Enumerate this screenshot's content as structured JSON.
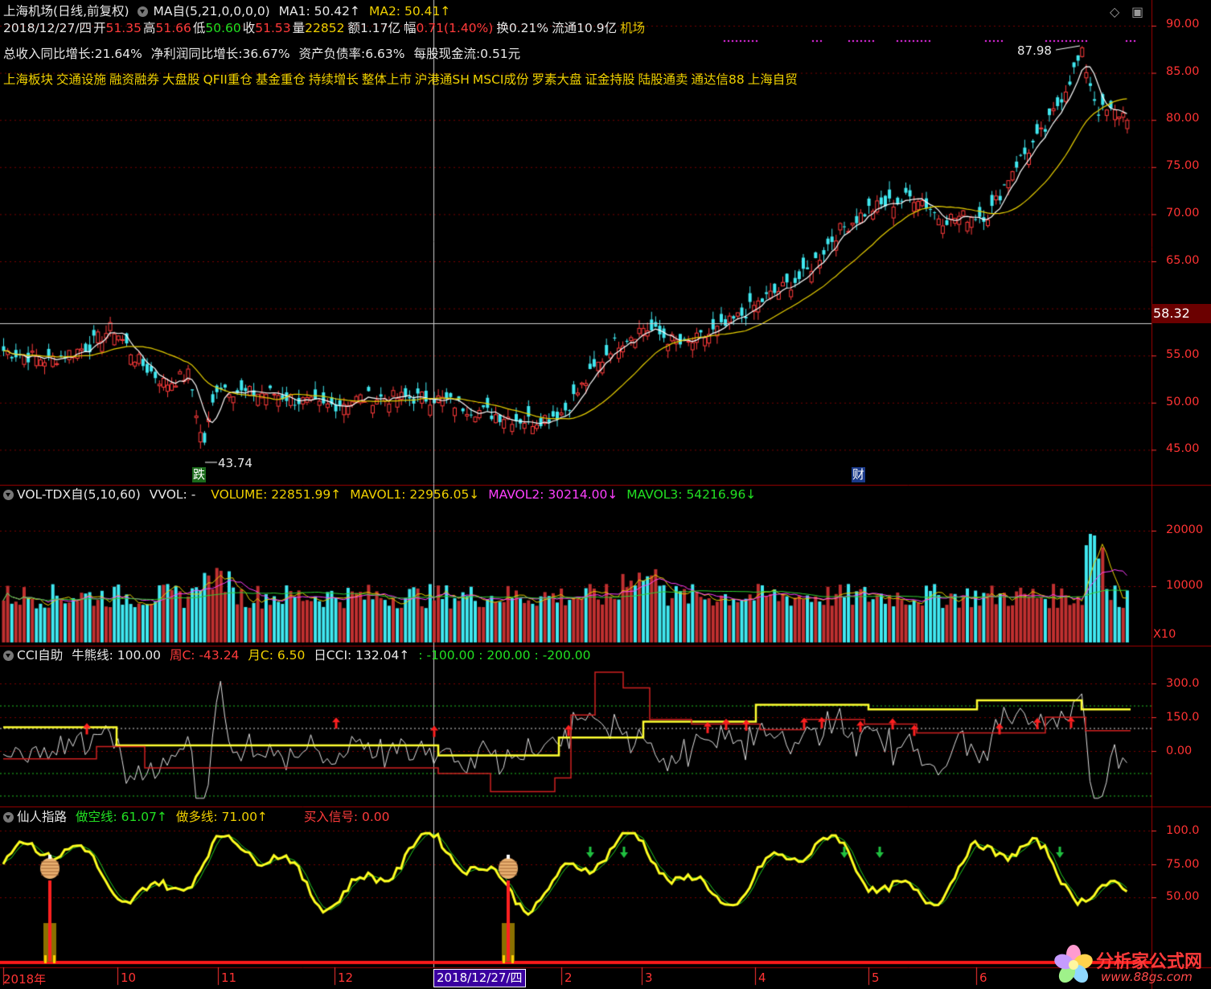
{
  "header": {
    "stock_name": "上海机场",
    "period": "(日线,前复权)",
    "ma_indicator": "MA自(5,21,0,0,0,0)",
    "ma1": "MA1: 50.42↑",
    "ma2": "MA2: 50.41↑",
    "date": "2018/12/27/四",
    "open_label": "开",
    "open": "51.35",
    "high_label": "高",
    "high": "51.66",
    "low_label": "低",
    "low": "50.60",
    "close_label": "收",
    "close": "51.53",
    "vol_label": "量",
    "vol": "22852",
    "amount": "额1.17亿",
    "change_label": "幅",
    "change": "0.71(1.40%)",
    "turnover": "换0.21%",
    "float": "流通10.9亿",
    "industry": "机场"
  },
  "fundamentals": [
    "总收入同比增长:21.64%",
    "净利润同比增长:36.67%",
    "资产负债率:6.63%",
    "每股现金流:0.51元"
  ],
  "concepts": [
    "上海板块",
    "交通设施",
    "融资融券",
    "大盘股",
    "QFII重仓",
    "基金重仓",
    "持续增长",
    "整体上市",
    "沪港通SH",
    "MSCI成份",
    "罗素大盘",
    "证金持股",
    "陆股通卖",
    "通达信88",
    "上海自贸"
  ],
  "price_panel": {
    "y_ticks": [
      "90.00",
      "85.00",
      "80.00",
      "75.00",
      "70.00",
      "65.00",
      "55.00",
      "50.00",
      "45.00"
    ],
    "crosshair_price": "58.32",
    "max_label": "87.98",
    "min_label": "43.74",
    "event_marker_1": "跌",
    "event_marker_2": "财"
  },
  "volume_panel": {
    "name": "VOL-TDX自(5,10,60)",
    "vvol": "VVOL: -",
    "volume": "VOLUME: 22851.99↑",
    "mavol1": "MAVOL1: 22956.05↓",
    "mavol2": "MAVOL2: 30214.00↓",
    "mavol3": "MAVOL3: 54216.96↓",
    "y_ticks": [
      "20000",
      "10000"
    ],
    "unit": "X10"
  },
  "cci_panel": {
    "name": "CCI自助",
    "bull_bear": "牛熊线: 100.00",
    "week": "周C: -43.24",
    "month": "月C: 6.50",
    "day": "日CCI: 132.04↑",
    "levels": ": -100.00 : 200.00 : -200.00",
    "y_ticks": [
      "300.0",
      "150.0",
      "0.00"
    ]
  },
  "xianren_panel": {
    "name": "仙人指路",
    "short": "做空线: 61.07↑",
    "long": "做多线: 71.00↑",
    "buy": "买入信号: 0.00",
    "y_ticks": [
      "100.0",
      "75.00",
      "50.00"
    ]
  },
  "x_axis": {
    "labels": [
      "2018年",
      "10",
      "11",
      "12",
      "2",
      "3",
      "4",
      "5",
      "6"
    ],
    "crosshair_date": "2018/12/27/四"
  },
  "watermark": {
    "title": "分析家公式网",
    "url": "www.88gs.com"
  },
  "colors": {
    "up": "#ff3b3b",
    "down": "#40e8f0",
    "ma1": "#ffffff",
    "ma2": "#e8d000",
    "grid": "#7a0000",
    "frame": "#a00000"
  },
  "icons": [
    "diamond-icon",
    "maximize-icon",
    "dropdown-circle-icon"
  ]
}
